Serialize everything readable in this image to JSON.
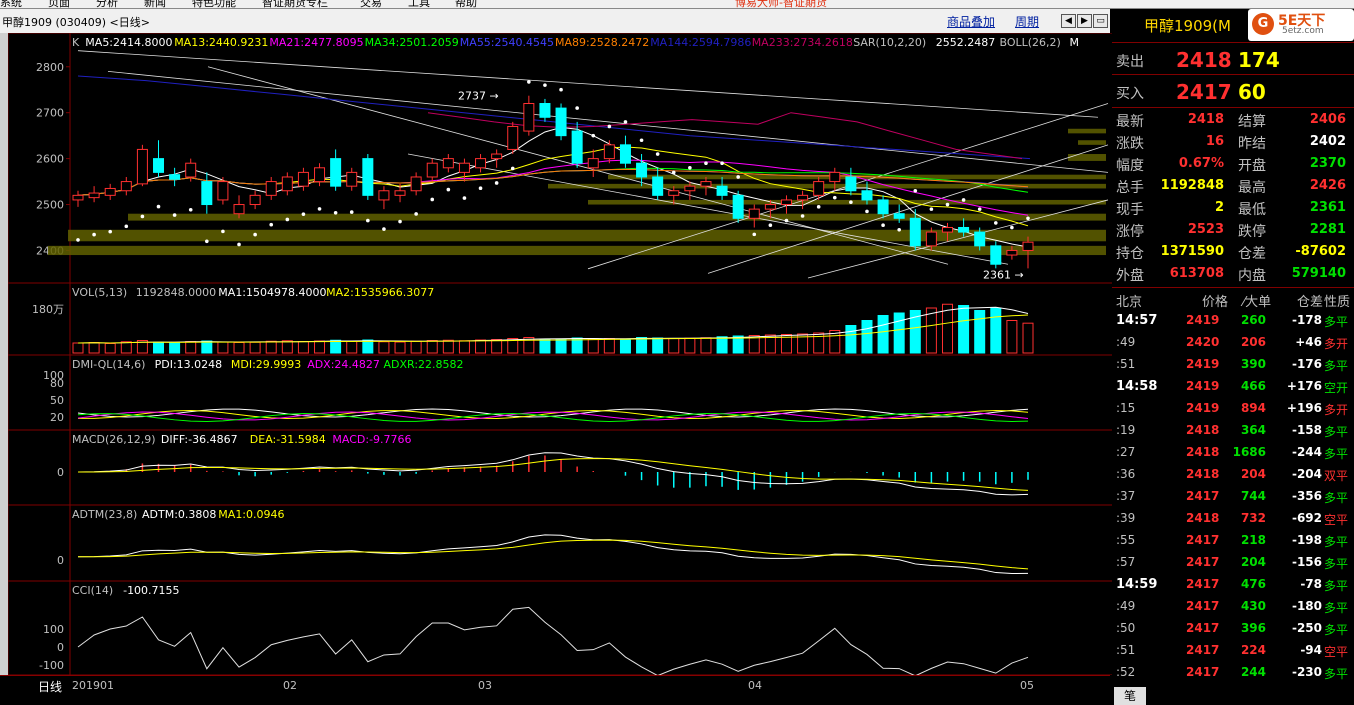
{
  "menubar": [
    "系统",
    "页面",
    "分析",
    "新闻",
    "特色功能",
    "智证期货专栏",
    "交易",
    "工具",
    "帮助"
  ],
  "menubar_brand": "博易大师-智证期货",
  "window": {
    "title": "甲醇1909 (030409) <日线>",
    "tab_overlay": "商品叠加",
    "tab_period": "周期"
  },
  "colors": {
    "up": "#ff3030",
    "down": "#00ffff",
    "ma5": "#ffffff",
    "ma13": "#ffff00",
    "ma21": "#ff00ff",
    "ma34": "#00ff00",
    "ma55": "#4040ff",
    "ma89": "#ff8000",
    "ma233": "#c00060",
    "sar": "#ffffff",
    "boll": "#ffff00",
    "panel_border": "#800000",
    "volume_zone": "#606000"
  },
  "main_panel": {
    "legend": [
      {
        "text": "K",
        "color": "#c0c0c0"
      },
      {
        "text": "MA5:2414.8000",
        "color": "#ffffff"
      },
      {
        "text": "MA13:2440.9231",
        "color": "#ffff00"
      },
      {
        "text": "MA21:2477.8095",
        "color": "#ff00ff"
      },
      {
        "text": "MA34:2501.2059",
        "color": "#00ff00"
      },
      {
        "text": "MA55:2540.4545",
        "color": "#4040ff"
      },
      {
        "text": "MA89:2528.2472",
        "color": "#ff8000"
      },
      {
        "text": "MA144:2594.7986",
        "color": "#2020c0"
      },
      {
        "text": "MA233:2734.2618",
        "color": "#c00060"
      },
      {
        "text": "SAR(10,2,20)",
        "color": "#c0c0c0"
      },
      {
        "text": "2552.2487",
        "color": "#ffffff"
      },
      {
        "text": "BOLL(26,2)",
        "color": "#c0c0c0"
      },
      {
        "text": "M",
        "color": "#ffffff"
      }
    ],
    "y_ticks": [
      "2800",
      "2700",
      "2600",
      "2500",
      "2400"
    ],
    "annot_high": "2737",
    "annot_low": "2361"
  },
  "vol_panel": {
    "legend": [
      {
        "text": "VOL(5,13)",
        "color": "#c0c0c0"
      },
      {
        "text": "1192848.0000",
        "color": "#c0c0c0"
      },
      {
        "text": "MA1:1504978.4000",
        "color": "#ffffff"
      },
      {
        "text": "MA2:1535966.3077",
        "color": "#ffff00"
      }
    ],
    "y_tick": "180万"
  },
  "dmi_panel": {
    "legend": [
      {
        "text": "DMI-QL(14,6)",
        "color": "#c0c0c0"
      },
      {
        "text": "PDI:13.0248",
        "color": "#ffffff"
      },
      {
        "text": "MDI:29.9993",
        "color": "#ffff00"
      },
      {
        "text": "ADX:24.4827",
        "color": "#ff00ff"
      },
      {
        "text": "ADXR:22.8582",
        "color": "#00ff00"
      }
    ],
    "y_ticks": [
      "100",
      "80",
      "50",
      "20"
    ]
  },
  "macd_panel": {
    "legend": [
      {
        "text": "MACD(26,12,9)",
        "color": "#c0c0c0"
      },
      {
        "text": "DIFF:-36.4867",
        "color": "#ffffff"
      },
      {
        "text": "DEA:-31.5984",
        "color": "#ffff00"
      },
      {
        "text": "MACD:-9.7766",
        "color": "#ff00ff"
      }
    ],
    "y_tick": "0"
  },
  "adtm_panel": {
    "legend": [
      {
        "text": "ADTM(23,8)",
        "color": "#c0c0c0"
      },
      {
        "text": "ADTM:0.3808",
        "color": "#ffffff"
      },
      {
        "text": "MA1:0.0946",
        "color": "#ffff00"
      }
    ],
    "y_tick": "0"
  },
  "cci_panel": {
    "legend": [
      {
        "text": "CCI(14)",
        "color": "#c0c0c0"
      },
      {
        "text": "-100.7155",
        "color": "#ffffff"
      }
    ],
    "y_ticks": [
      "100",
      "0",
      "-100"
    ]
  },
  "bottom": {
    "period": "日线",
    "dates": [
      "201901",
      "02",
      "03",
      "04",
      "05"
    ]
  },
  "chart_data": {
    "type": "candlestick",
    "ohlc": [
      [
        2510,
        2530,
        2495,
        2520
      ],
      [
        2515,
        2540,
        2505,
        2525
      ],
      [
        2520,
        2545,
        2510,
        2535
      ],
      [
        2530,
        2560,
        2520,
        2550
      ],
      [
        2545,
        2630,
        2540,
        2620
      ],
      [
        2600,
        2640,
        2560,
        2570
      ],
      [
        2565,
        2580,
        2540,
        2555
      ],
      [
        2560,
        2600,
        2550,
        2590
      ],
      [
        2550,
        2570,
        2480,
        2500
      ],
      [
        2510,
        2560,
        2500,
        2550
      ],
      [
        2480,
        2520,
        2470,
        2500
      ],
      [
        2500,
        2530,
        2490,
        2520
      ],
      [
        2520,
        2560,
        2510,
        2550
      ],
      [
        2530,
        2570,
        2520,
        2560
      ],
      [
        2540,
        2580,
        2530,
        2570
      ],
      [
        2550,
        2590,
        2540,
        2580
      ],
      [
        2600,
        2620,
        2530,
        2540
      ],
      [
        2540,
        2580,
        2530,
        2570
      ],
      [
        2600,
        2610,
        2510,
        2520
      ],
      [
        2510,
        2540,
        2490,
        2530
      ],
      [
        2520,
        2545,
        2505,
        2530
      ],
      [
        2530,
        2570,
        2520,
        2560
      ],
      [
        2560,
        2600,
        2550,
        2590
      ],
      [
        2580,
        2610,
        2570,
        2600
      ],
      [
        2570,
        2600,
        2550,
        2590
      ],
      [
        2580,
        2610,
        2570,
        2600
      ],
      [
        2600,
        2620,
        2580,
        2610
      ],
      [
        2620,
        2680,
        2610,
        2670
      ],
      [
        2660,
        2737,
        2650,
        2720
      ],
      [
        2720,
        2730,
        2680,
        2690
      ],
      [
        2710,
        2720,
        2640,
        2650
      ],
      [
        2660,
        2680,
        2580,
        2590
      ],
      [
        2580,
        2620,
        2560,
        2600
      ],
      [
        2600,
        2640,
        2590,
        2630
      ],
      [
        2630,
        2650,
        2580,
        2590
      ],
      [
        2590,
        2610,
        2540,
        2560
      ],
      [
        2560,
        2580,
        2510,
        2520
      ],
      [
        2520,
        2540,
        2500,
        2530
      ],
      [
        2530,
        2550,
        2510,
        2540
      ],
      [
        2540,
        2560,
        2520,
        2550
      ],
      [
        2540,
        2560,
        2510,
        2520
      ],
      [
        2520,
        2530,
        2460,
        2470
      ],
      [
        2470,
        2500,
        2450,
        2490
      ],
      [
        2490,
        2510,
        2470,
        2500
      ],
      [
        2500,
        2520,
        2480,
        2510
      ],
      [
        2510,
        2530,
        2490,
        2520
      ],
      [
        2520,
        2560,
        2510,
        2550
      ],
      [
        2550,
        2580,
        2530,
        2570
      ],
      [
        2560,
        2580,
        2520,
        2530
      ],
      [
        2530,
        2550,
        2500,
        2510
      ],
      [
        2510,
        2520,
        2470,
        2480
      ],
      [
        2480,
        2500,
        2460,
        2470
      ],
      [
        2470,
        2490,
        2400,
        2410
      ],
      [
        2410,
        2450,
        2400,
        2440
      ],
      [
        2440,
        2460,
        2420,
        2450
      ],
      [
        2450,
        2470,
        2430,
        2440
      ],
      [
        2440,
        2450,
        2400,
        2410
      ],
      [
        2410,
        2420,
        2361,
        2370
      ],
      [
        2390,
        2410,
        2380,
        2400
      ],
      [
        2400,
        2430,
        2361,
        2418
      ]
    ],
    "volume_k": [
      400,
      420,
      380,
      450,
      500,
      430,
      410,
      460,
      480,
      440,
      420,
      430,
      470,
      490,
      460,
      480,
      510,
      470,
      520,
      450,
      440,
      470,
      500,
      510,
      490,
      520,
      540,
      580,
      620,
      560,
      540,
      600,
      570,
      580,
      560,
      620,
      600,
      580,
      590,
      610,
      650,
      680,
      700,
      720,
      740,
      760,
      800,
      900,
      1100,
      1300,
      1500,
      1600,
      1700,
      1800,
      1950,
      1900,
      1700,
      1800,
      1300,
      1192.848
    ],
    "y_range": [
      2340,
      2830
    ],
    "x_dates": [
      "201901",
      "02",
      "03",
      "04",
      "05"
    ]
  },
  "quote": {
    "name": "甲醇1909(M",
    "sell_label": "卖出",
    "sell_price": "2418",
    "sell_vol": "174",
    "buy_label": "买入",
    "buy_price": "2417",
    "buy_vol": "60",
    "stats": [
      {
        "l1": "最新",
        "v1": "2418",
        "c1": "red",
        "l2": "结算",
        "v2": "2406",
        "c2": "red"
      },
      {
        "l1": "涨跌",
        "v1": "16",
        "c1": "red",
        "l2": "昨结",
        "v2": "2402",
        "c2": "wht"
      },
      {
        "l1": "幅度",
        "v1": "0.67%",
        "c1": "red",
        "l2": "开盘",
        "v2": "2370",
        "c2": "grn"
      },
      {
        "l1": "总手",
        "v1": "1192848",
        "c1": "yel",
        "l2": "最高",
        "v2": "2426",
        "c2": "red"
      },
      {
        "l1": "现手",
        "v1": "2",
        "c1": "yel",
        "l2": "最低",
        "v2": "2361",
        "c2": "grn"
      },
      {
        "l1": "涨停",
        "v1": "2523",
        "c1": "red",
        "l2": "跌停",
        "v2": "2281",
        "c2": "grn"
      },
      {
        "l1": "持仓",
        "v1": "1371590",
        "c1": "yel",
        "l2": "仓差",
        "v2": "-87602",
        "c2": "yel"
      },
      {
        "l1": "外盘",
        "v1": "613708",
        "c1": "red",
        "l2": "内盘",
        "v2": "579140",
        "c2": "grn"
      }
    ],
    "ticks_header": [
      "北京",
      "价格",
      "⁄大单",
      "仓差",
      "性质"
    ],
    "ticks": [
      {
        "t": "14:57",
        "big": true,
        "p": "2419",
        "v": "260",
        "vc": "grn",
        "c": "-178",
        "cc": "wht",
        "n": "多平",
        "nc": "grn"
      },
      {
        "t": ":49",
        "big": false,
        "p": "2420",
        "v": "206",
        "vc": "red",
        "c": "+46",
        "cc": "wht",
        "n": "多开",
        "nc": "red"
      },
      {
        "t": ":51",
        "big": false,
        "p": "2419",
        "v": "390",
        "vc": "grn",
        "c": "-176",
        "cc": "wht",
        "n": "多平",
        "nc": "grn"
      },
      {
        "t": "14:58",
        "big": true,
        "p": "2419",
        "v": "466",
        "vc": "grn",
        "c": "+176",
        "cc": "wht",
        "n": "空开",
        "nc": "grn"
      },
      {
        "t": ":15",
        "big": false,
        "p": "2419",
        "v": "894",
        "vc": "red",
        "c": "+196",
        "cc": "wht",
        "n": "多开",
        "nc": "red"
      },
      {
        "t": ":19",
        "big": false,
        "p": "2418",
        "v": "364",
        "vc": "grn",
        "c": "-158",
        "cc": "wht",
        "n": "多平",
        "nc": "grn"
      },
      {
        "t": ":27",
        "big": false,
        "p": "2418",
        "v": "1686",
        "vc": "grn",
        "c": "-244",
        "cc": "wht",
        "n": "多平",
        "nc": "grn"
      },
      {
        "t": ":36",
        "big": false,
        "p": "2418",
        "v": "204",
        "vc": "red",
        "c": "-204",
        "cc": "wht",
        "n": "双平",
        "nc": "red"
      },
      {
        "t": ":37",
        "big": false,
        "p": "2417",
        "v": "744",
        "vc": "grn",
        "c": "-356",
        "cc": "wht",
        "n": "多平",
        "nc": "grn"
      },
      {
        "t": ":39",
        "big": false,
        "p": "2418",
        "v": "732",
        "vc": "red",
        "c": "-692",
        "cc": "wht",
        "n": "空平",
        "nc": "red"
      },
      {
        "t": ":55",
        "big": false,
        "p": "2417",
        "v": "218",
        "vc": "grn",
        "c": "-198",
        "cc": "wht",
        "n": "多平",
        "nc": "grn"
      },
      {
        "t": ":57",
        "big": false,
        "p": "2417",
        "v": "204",
        "vc": "grn",
        "c": "-156",
        "cc": "wht",
        "n": "多平",
        "nc": "grn"
      },
      {
        "t": "14:59",
        "big": true,
        "p": "2417",
        "v": "476",
        "vc": "grn",
        "c": "-78",
        "cc": "wht",
        "n": "多平",
        "nc": "grn"
      },
      {
        "t": ":49",
        "big": false,
        "p": "2417",
        "v": "430",
        "vc": "grn",
        "c": "-180",
        "cc": "wht",
        "n": "多平",
        "nc": "grn"
      },
      {
        "t": ":50",
        "big": false,
        "p": "2417",
        "v": "396",
        "vc": "grn",
        "c": "-250",
        "cc": "wht",
        "n": "多平",
        "nc": "grn"
      },
      {
        "t": ":51",
        "big": false,
        "p": "2417",
        "v": "224",
        "vc": "red",
        "c": "-94",
        "cc": "wht",
        "n": "空平",
        "nc": "red"
      },
      {
        "t": ":52",
        "big": false,
        "p": "2417",
        "v": "244",
        "vc": "grn",
        "c": "-230",
        "cc": "wht",
        "n": "多平",
        "nc": "grn"
      }
    ],
    "footer_tab": "笔"
  }
}
